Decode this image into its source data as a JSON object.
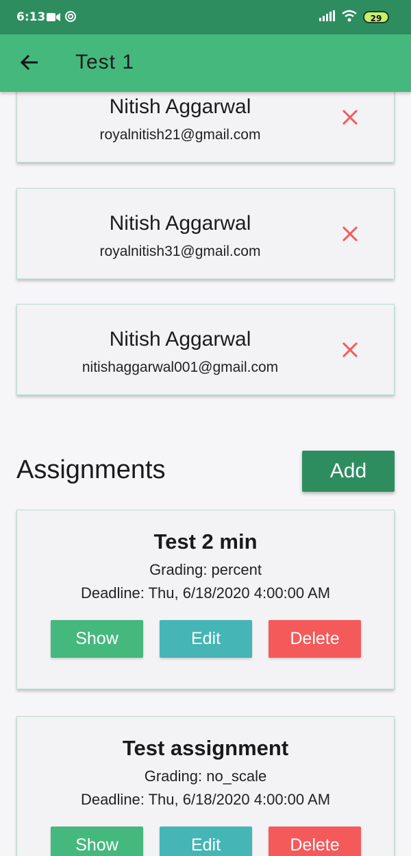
{
  "status_bar": {
    "time": "6:13",
    "battery": "29",
    "icons": [
      "video-camera-icon",
      "sync-icon",
      "signal-icon",
      "wifi-icon",
      "battery-icon"
    ]
  },
  "app_bar": {
    "title": "Test  1",
    "back_icon": "arrow-left-icon"
  },
  "members": [
    {
      "name": "Nitish Aggarwal",
      "email": "royalnitish21@gmail.com"
    },
    {
      "name": "Nitish Aggarwal",
      "email": "royalnitish31@gmail.com"
    },
    {
      "name": "Nitish Aggarwal",
      "email": "nitishaggarwal001@gmail.com"
    }
  ],
  "assignments_section": {
    "title": "Assignments",
    "add_label": "Add"
  },
  "assignments": [
    {
      "title": "Test 2 min",
      "grading": "Grading: percent",
      "deadline": "Deadline: Thu, 6/18/2020 4:00:00 AM",
      "show_label": "Show",
      "edit_label": "Edit",
      "delete_label": "Delete"
    },
    {
      "title": "Test assignment",
      "grading": "Grading: no_scale",
      "deadline": "Deadline: Thu, 6/18/2020 4:00:00 AM",
      "show_label": "Show",
      "edit_label": "Edit",
      "delete_label": "Delete"
    }
  ],
  "colors": {
    "primary": "#45b87d",
    "primary_dark": "#2e8d5f",
    "edit": "#45b5b5",
    "delete": "#f45a5a"
  }
}
